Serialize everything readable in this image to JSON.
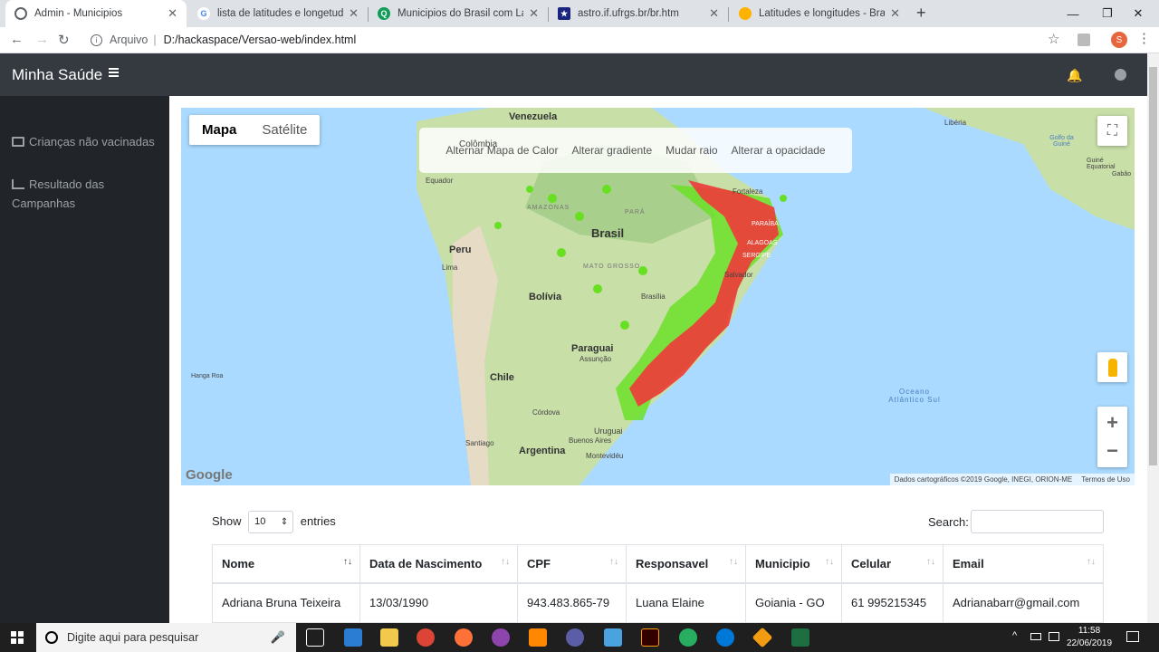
{
  "browser": {
    "tabs": [
      {
        "title": "Admin - Municipios",
        "active": true,
        "favicon": "globe-icon"
      },
      {
        "title": "lista de latitudes e longetudes ci",
        "favicon": "google-icon"
      },
      {
        "title": "Municipios do Brasil com Latitud",
        "favicon": "qualidade-icon"
      },
      {
        "title": "astro.if.ufrgs.br/br.htm",
        "favicon": "star-icon"
      },
      {
        "title": "Latitudes e longitudes - Brasil Esc",
        "favicon": "brazil-icon"
      }
    ],
    "address": {
      "prefix": "Arquivo",
      "url": "D:/hackaspace/Versao-web/index.html"
    },
    "profile_letter": "S"
  },
  "app": {
    "brand": "Minha Saúde",
    "sidebar": [
      {
        "label": "Crianças não vacinadas",
        "icon": "table-icon"
      },
      {
        "label": "Resultado das Campanhas",
        "icon": "area-chart-icon"
      }
    ]
  },
  "map": {
    "types": [
      "Mapa",
      "Satélite"
    ],
    "controls": [
      "Alternar Mapa de Calor",
      "Alterar gradiente",
      "Mudar raio",
      "Alterar a opacidade"
    ],
    "labels": {
      "venezuela": "Venezuela",
      "colombia": "Colômbia",
      "equador": "Equador",
      "peru": "Peru",
      "lima": "Lima",
      "brasil": "Brasil",
      "bolivia": "Bolívia",
      "paraguai": "Paraguai",
      "assuncao": "Assunção",
      "chile": "Chile",
      "argentina": "Argentina",
      "cordova": "Córdova",
      "santiago": "Santiago",
      "buenos_aires": "Buenos Aires",
      "montevideu": "Montevidéu",
      "uruguai": "Uruguai",
      "fortaleza": "Fortaleza",
      "salvador": "Salvador",
      "brasilia": "Brasília",
      "liberia": "Libéria",
      "golfo": "Golfo da Guiné",
      "guine_eq": "Guiné Equatorial",
      "gabao": "Gabão",
      "hanga_roa": "Hanga Roa",
      "oceano": "Oceano Atlântico Sul",
      "amazonas": "AMAZONAS",
      "para": "PARÁ",
      "mato_grosso": "MATO GROSSO",
      "paraiba": "PARAÍBA",
      "alagoas": "ALAGOAS",
      "sergipe": "SERGIPE"
    },
    "google": "Google",
    "attribution": "Dados cartográficos ©2019 Google, INEGI, ORION-ME",
    "terms": "Termos de Uso"
  },
  "datatable": {
    "show": "Show",
    "entries_value": "10",
    "entries": "entries",
    "search_label": "Search:",
    "columns": [
      "Nome",
      "Data de Nascimento",
      "CPF",
      "Responsavel",
      "Municipio",
      "Celular",
      "Email"
    ],
    "rows": [
      [
        "Adriana Bruna Teixeira",
        "13/03/1990",
        "943.483.865-79",
        "Luana Elaine",
        "Goiania - GO",
        "61 995215345",
        "Adrianabarr@gmail.com"
      ]
    ]
  },
  "taskbar": {
    "search_placeholder": "Digite aqui para pesquisar",
    "time": "11:58",
    "date": "22/06/2019"
  },
  "colors": {
    "navbar": "#343a40",
    "sidebar": "#212529",
    "heat_hot": "#ff0000",
    "heat_cool": "#66ff00"
  }
}
